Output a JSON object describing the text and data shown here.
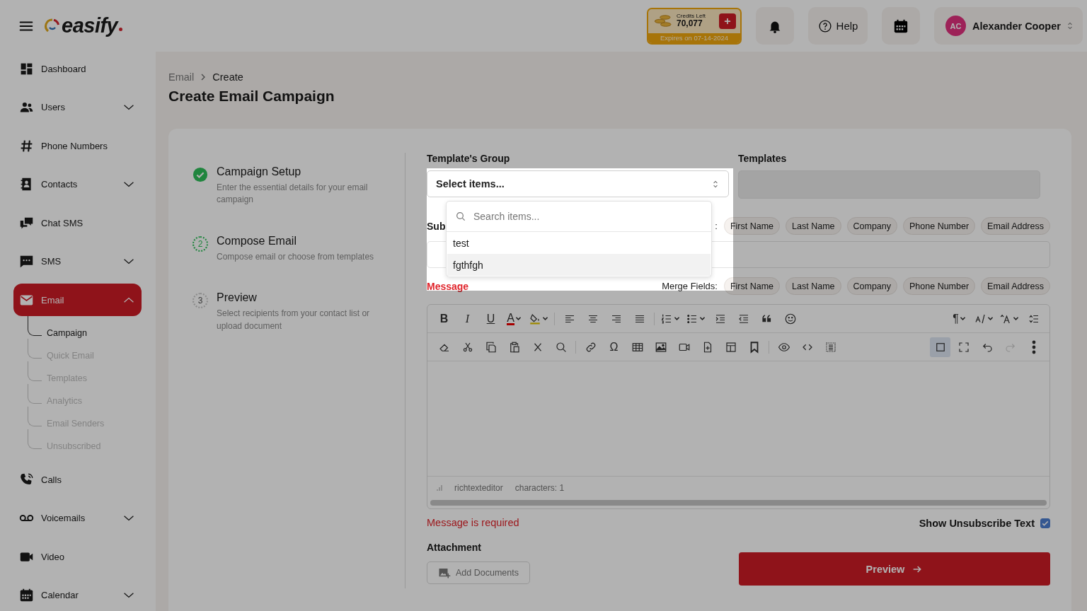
{
  "header": {
    "logo": "easify",
    "credits": {
      "label": "Credits Left",
      "value": "70,077",
      "expires": "Expires on 07-14-2024"
    },
    "help": "Help",
    "user": {
      "initials": "AC",
      "name": "Alexander Cooper"
    }
  },
  "sidebar": {
    "items": [
      {
        "label": "Dashboard",
        "expandable": false,
        "selected": false
      },
      {
        "label": "Users",
        "expandable": true,
        "expanded": false,
        "selected": false
      },
      {
        "label": "Phone Numbers",
        "expandable": false,
        "selected": false
      },
      {
        "label": "Contacts",
        "expandable": true,
        "expanded": false,
        "selected": false
      },
      {
        "label": "Chat SMS",
        "expandable": false,
        "selected": false
      },
      {
        "label": "SMS",
        "expandable": true,
        "expanded": false,
        "selected": false
      },
      {
        "label": "Email",
        "expandable": true,
        "expanded": true,
        "selected": true,
        "children": [
          {
            "label": "Campaign",
            "selected": true
          },
          {
            "label": "Quick Email",
            "selected": false
          },
          {
            "label": "Templates",
            "selected": false
          },
          {
            "label": "Analytics",
            "selected": false
          },
          {
            "label": "Email Senders",
            "selected": false
          },
          {
            "label": "Unsubscribed",
            "selected": false
          }
        ]
      },
      {
        "label": "Calls",
        "expandable": false,
        "selected": false
      },
      {
        "label": "Voicemails",
        "expandable": true,
        "expanded": false,
        "selected": false
      },
      {
        "label": "Video",
        "expandable": false,
        "selected": false
      },
      {
        "label": "Calendar",
        "expandable": true,
        "expanded": false,
        "selected": false
      }
    ]
  },
  "breadcrumb": [
    "Email",
    "Create"
  ],
  "title": "Create Email Campaign",
  "steps": [
    {
      "title": "Campaign Setup",
      "description": "Enter the essential details for your email campaign",
      "completed": true,
      "current": false
    },
    {
      "number": "2",
      "title": "Compose Email",
      "description": "Compose email or choose from templates",
      "completed": false,
      "current": true
    },
    {
      "number": "3",
      "title": "Preview",
      "description": "Select recipients from your contact list or upload document",
      "completed": false,
      "current": false
    }
  ],
  "form": {
    "templates_group": {
      "label": "Template's Group",
      "prompt": "Select items...",
      "expanded": true,
      "search_placeholder": "Search items...",
      "options": [
        {
          "label": "test",
          "selected": false
        },
        {
          "label": "fgthfgh",
          "selected": true
        }
      ]
    },
    "templates": {
      "label": "Templates",
      "disabled": true
    },
    "subject": {
      "label": "Sub",
      "merge_label": ":",
      "merge_fields": [
        "First Name",
        "Last Name",
        "Company",
        "Phone Number",
        "Email Address"
      ]
    },
    "message": {
      "label": "Message",
      "invalid": true,
      "merge_label": "Merge Fields:",
      "merge_fields": [
        "First Name",
        "Last Name",
        "Company",
        "Phone Number",
        "Email Address"
      ],
      "toolbar": {
        "rows": [
          {
            "groups": [
              [
                {
                  "kind": "bold",
                  "label": "B",
                  "caret": false,
                  "active": false,
                  "disabled": false
                },
                {
                  "kind": "italic",
                  "label": "I",
                  "caret": false,
                  "active": false,
                  "disabled": false
                },
                {
                  "kind": "underline",
                  "label": "U",
                  "caret": false,
                  "active": false,
                  "disabled": false
                },
                {
                  "kind": "font-color",
                  "label": "A",
                  "caret": true,
                  "active": false,
                  "disabled": false
                },
                {
                  "kind": "highlight",
                  "caret": true,
                  "active": false,
                  "disabled": false
                }
              ],
              [
                {
                  "kind": "align-left",
                  "caret": false,
                  "active": false,
                  "disabled": false
                },
                {
                  "kind": "align-center",
                  "caret": false,
                  "active": false,
                  "disabled": false
                },
                {
                  "kind": "align-right",
                  "caret": false,
                  "active": false,
                  "disabled": false
                },
                {
                  "kind": "justify",
                  "caret": false,
                  "active": false,
                  "disabled": false
                }
              ],
              [
                {
                  "kind": "numbered-list",
                  "caret": true,
                  "active": false,
                  "disabled": false
                },
                {
                  "kind": "bullet-list",
                  "caret": true,
                  "active": false,
                  "disabled": false
                },
                {
                  "kind": "indent",
                  "caret": false,
                  "active": false,
                  "disabled": false
                },
                {
                  "kind": "outdent",
                  "caret": false,
                  "active": false,
                  "disabled": false
                },
                {
                  "kind": "quote",
                  "caret": false,
                  "active": false,
                  "disabled": false
                },
                {
                  "kind": "emoji",
                  "caret": false,
                  "active": false,
                  "disabled": false
                }
              ]
            ],
            "end": [
              {
                "kind": "paragraph",
                "label": "¶",
                "caret": true,
                "active": false,
                "disabled": false
              },
              {
                "kind": "text-direction",
                "caret": true,
                "active": false,
                "disabled": false
              },
              {
                "kind": "font-size",
                "caret": true,
                "active": false,
                "disabled": false
              },
              {
                "kind": "line-height",
                "caret": false,
                "active": false,
                "disabled": false
              }
            ]
          },
          {
            "groups": [
              [
                {
                  "kind": "eraser",
                  "caret": false,
                  "active": false,
                  "disabled": false
                },
                {
                  "kind": "cut",
                  "caret": false,
                  "active": false,
                  "disabled": false
                },
                {
                  "kind": "copy",
                  "caret": false,
                  "active": false,
                  "disabled": false
                },
                {
                  "kind": "paste",
                  "caret": false,
                  "active": false,
                  "disabled": false
                },
                {
                  "kind": "clear-format",
                  "caret": false,
                  "active": false,
                  "disabled": false
                },
                {
                  "kind": "search",
                  "caret": false,
                  "active": false,
                  "disabled": false
                }
              ],
              [
                {
                  "kind": "link",
                  "caret": false,
                  "active": false,
                  "disabled": false
                },
                {
                  "kind": "symbol",
                  "label": "Ω",
                  "caret": false,
                  "active": false,
                  "disabled": false
                },
                {
                  "kind": "table",
                  "caret": false,
                  "active": false,
                  "disabled": false
                },
                {
                  "kind": "image",
                  "caret": false,
                  "active": false,
                  "disabled": false
                },
                {
                  "kind": "video",
                  "caret": false,
                  "active": false,
                  "disabled": false
                },
                {
                  "kind": "file",
                  "caret": false,
                  "active": false,
                  "disabled": false
                },
                {
                  "kind": "layout",
                  "caret": false,
                  "active": false,
                  "disabled": false
                },
                {
                  "kind": "bookmark",
                  "caret": false,
                  "active": false,
                  "disabled": false
                }
              ],
              [
                {
                  "kind": "preview",
                  "caret": false,
                  "active": false,
                  "disabled": false
                },
                {
                  "kind": "code",
                  "caret": false,
                  "active": false,
                  "disabled": false
                },
                {
                  "kind": "select-all",
                  "caret": false,
                  "active": false,
                  "disabled": false
                }
              ]
            ],
            "end": [
              {
                "kind": "frame",
                "caret": false,
                "active": true,
                "disabled": false
              },
              {
                "kind": "fullscreen",
                "caret": false,
                "active": false,
                "disabled": false
              },
              {
                "kind": "undo",
                "caret": false,
                "active": false,
                "disabled": false
              },
              {
                "kind": "redo",
                "caret": false,
                "active": false,
                "disabled": true
              },
              {
                "kind": "more",
                "caret": false,
                "active": false,
                "disabled": false
              }
            ]
          }
        ]
      },
      "status_label": "richtexteditor",
      "characters": "characters: 1",
      "error": "Message is required"
    },
    "unsubscribe": {
      "label": "Show Unsubscribe Text",
      "checked": true
    },
    "attachment": {
      "label": "Attachment",
      "button": "Add Documents"
    },
    "preview_button": "Preview"
  }
}
